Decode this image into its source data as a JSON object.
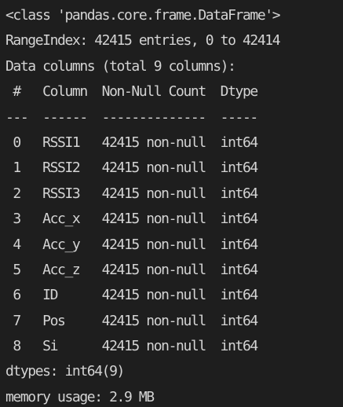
{
  "output": {
    "lines": [
      "<class 'pandas.core.frame.DataFrame'>",
      "RangeIndex: 42415 entries, 0 to 42414",
      "Data columns (total 9 columns):",
      " #   Column  Non-Null Count  Dtype",
      "---  ------  --------------  -----",
      " 0   RSSI1   42415 non-null  int64",
      " 1   RSSI2   42415 non-null  int64",
      " 2   RSSI3   42415 non-null  int64",
      " 3   Acc_x   42415 non-null  int64",
      " 4   Acc_y   42415 non-null  int64",
      " 5   Acc_z   42415 non-null  int64",
      " 6   ID      42415 non-null  int64",
      " 7   Pos     42415 non-null  int64",
      " 8   Si      42415 non-null  int64",
      "dtypes: int64(9)",
      "memory usage: 2.9 MB"
    ]
  }
}
